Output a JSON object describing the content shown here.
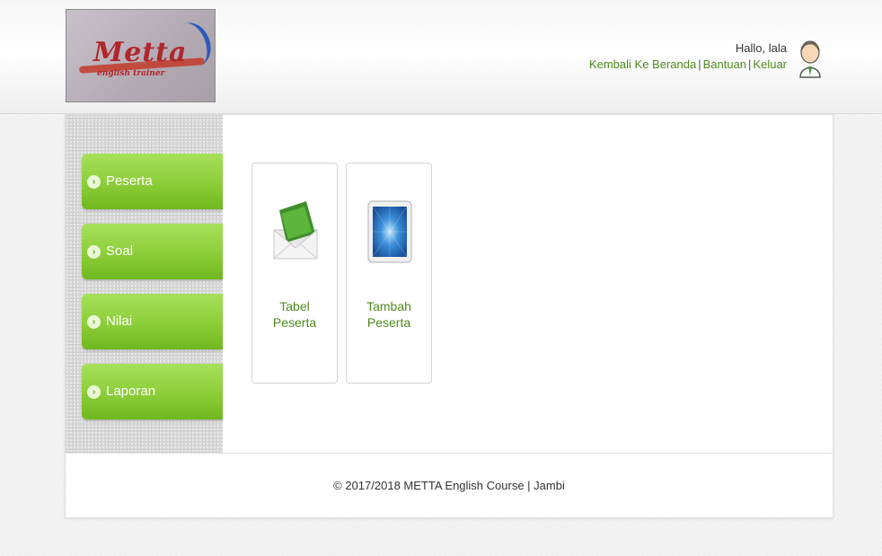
{
  "logo": {
    "brand": "Metta",
    "sub": "english trainer"
  },
  "user": {
    "greeting": "Hallo, lala"
  },
  "nav_links": {
    "home": "Kembali Ke Beranda",
    "help": "Bantuan",
    "logout": "Keluar",
    "separator": "|"
  },
  "sidebar": {
    "items": [
      {
        "label": "Peserta"
      },
      {
        "label": "Soal"
      },
      {
        "label": "Nilai"
      },
      {
        "label": "Laporan"
      }
    ]
  },
  "tiles": [
    {
      "line1": "Tabel",
      "line2": "Peserta",
      "icon": "envelope-icon"
    },
    {
      "line1": "Tambah",
      "line2": "Peserta",
      "icon": "tablet-icon"
    }
  ],
  "footer": {
    "text": "© 2017/2018 METTA English Course | Jambi"
  },
  "colors": {
    "accent_green": "#4f8a1c",
    "nav_green": "#8fcf3c"
  }
}
